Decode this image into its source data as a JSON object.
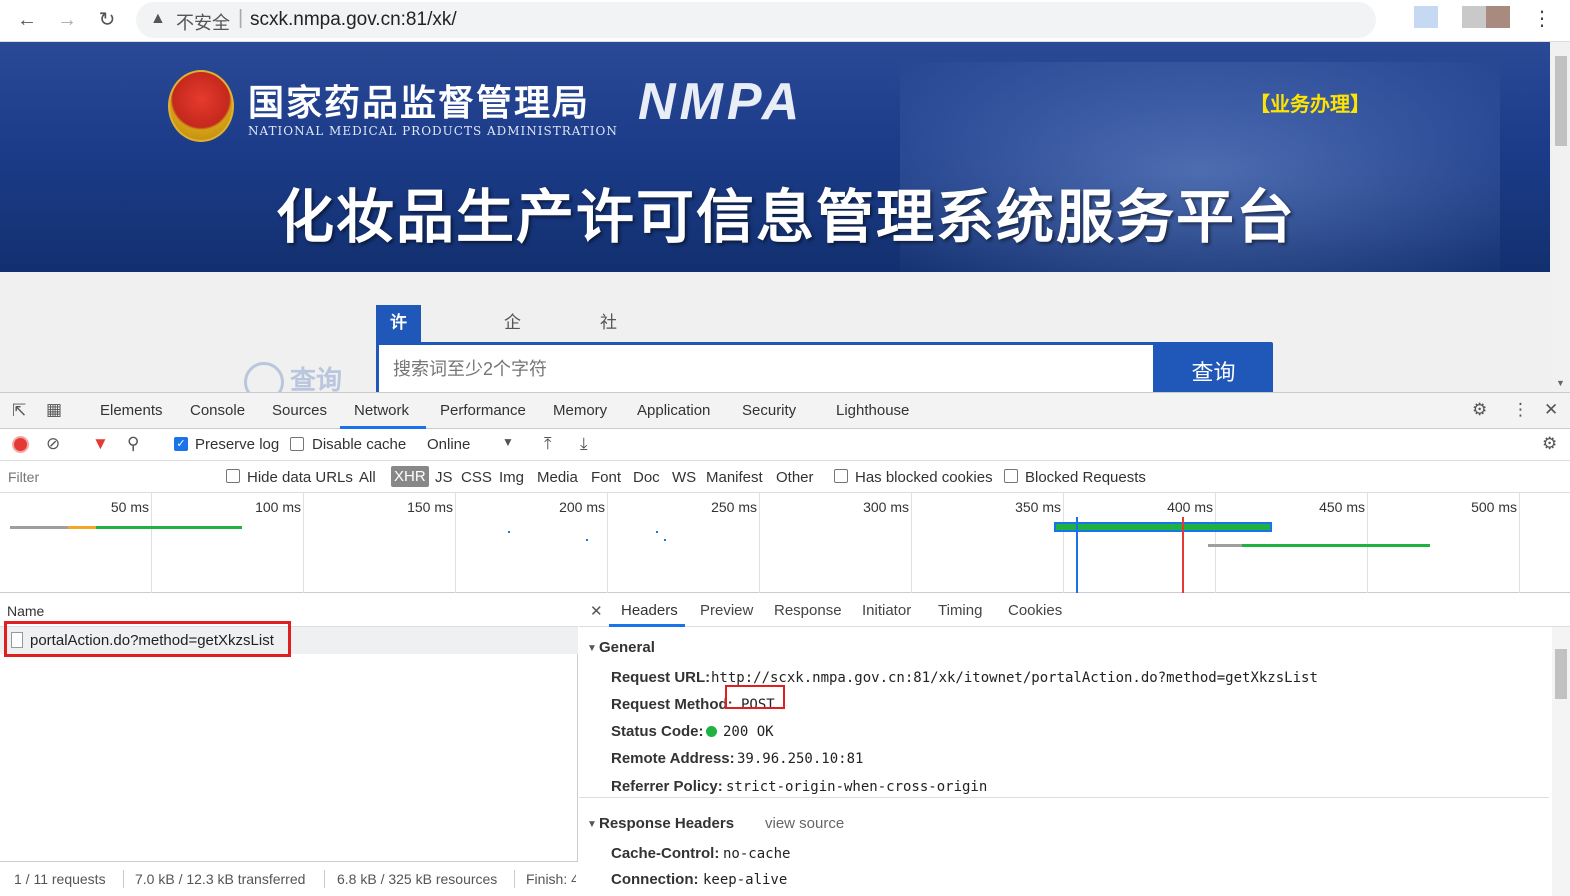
{
  "browser": {
    "security_label": "不安全",
    "url": "scxk.nmpa.gov.cn:81/xk/"
  },
  "banner": {
    "agency_cn": "国家药品监督管理局",
    "agency_en": "NATIONAL MEDICAL PRODUCTS ADMINISTRATION",
    "agency_abbr": "NMPA",
    "business_link": "【业务办理】",
    "platform_title": "化妆品生产许可信息管理系统服务平台"
  },
  "search": {
    "tabs": [
      "许可证编号",
      "企业名称",
      "社会信用代码"
    ],
    "active_tab": 0,
    "placeholder": "搜索词至少2个字符",
    "button_label": "查询",
    "watermark": "查询"
  },
  "devtools": {
    "tabs": [
      "Elements",
      "Console",
      "Sources",
      "Network",
      "Performance",
      "Memory",
      "Application",
      "Security",
      "Lighthouse"
    ],
    "active_tab": "Network",
    "toolbar": {
      "preserve_log": "Preserve log",
      "preserve_log_checked": true,
      "disable_cache": "Disable cache",
      "disable_cache_checked": false,
      "throttle": "Online"
    },
    "filter": {
      "placeholder": "Filter",
      "hide_data_urls": "Hide data URLs",
      "types": [
        "All",
        "XHR",
        "JS",
        "CSS",
        "Img",
        "Media",
        "Font",
        "Doc",
        "WS",
        "Manifest",
        "Other"
      ],
      "active_type": "XHR",
      "has_blocked_cookies": "Has blocked cookies",
      "blocked_requests": "Blocked Requests"
    },
    "timeline": {
      "ticks": [
        "50 ms",
        "100 ms",
        "150 ms",
        "200 ms",
        "250 ms",
        "300 ms",
        "350 ms",
        "400 ms",
        "450 ms",
        "500 ms"
      ]
    },
    "requests": {
      "column_name": "Name",
      "rows": [
        {
          "name": "portalAction.do?method=getXkzsList"
        }
      ]
    },
    "detail": {
      "tabs": [
        "Headers",
        "Preview",
        "Response",
        "Initiator",
        "Timing",
        "Cookies"
      ],
      "active_tab": "Headers",
      "general": {
        "title": "General",
        "request_url_key": "Request URL:",
        "request_url": "http://scxk.nmpa.gov.cn:81/xk/itownet/portalAction.do?method=getXkzsList",
        "request_method_key": "Request Method:",
        "request_method": "POST",
        "status_code_key": "Status Code:",
        "status_code": "200 OK",
        "remote_address_key": "Remote Address:",
        "remote_address": "39.96.250.10:81",
        "referrer_policy_key": "Referrer Policy:",
        "referrer_policy": "strict-origin-when-cross-origin"
      },
      "response_headers": {
        "title": "Response Headers",
        "view_source": "view source",
        "cache_control_key": "Cache-Control:",
        "cache_control": "no-cache",
        "connection_key": "Connection:",
        "connection": "keep-alive"
      }
    },
    "status": {
      "requests": "1 / 11 requests",
      "transferred": "7.0 kB / 12.3 kB transferred",
      "resources": "6.8 kB / 325 kB resources",
      "finish": "Finish: 4"
    }
  },
  "colors": {
    "accent": "#1a73e8",
    "banner_blue": "#1c3c8a",
    "search_blue": "#2058b9",
    "highlight_red": "#e02020",
    "status_green": "#1fb141"
  }
}
